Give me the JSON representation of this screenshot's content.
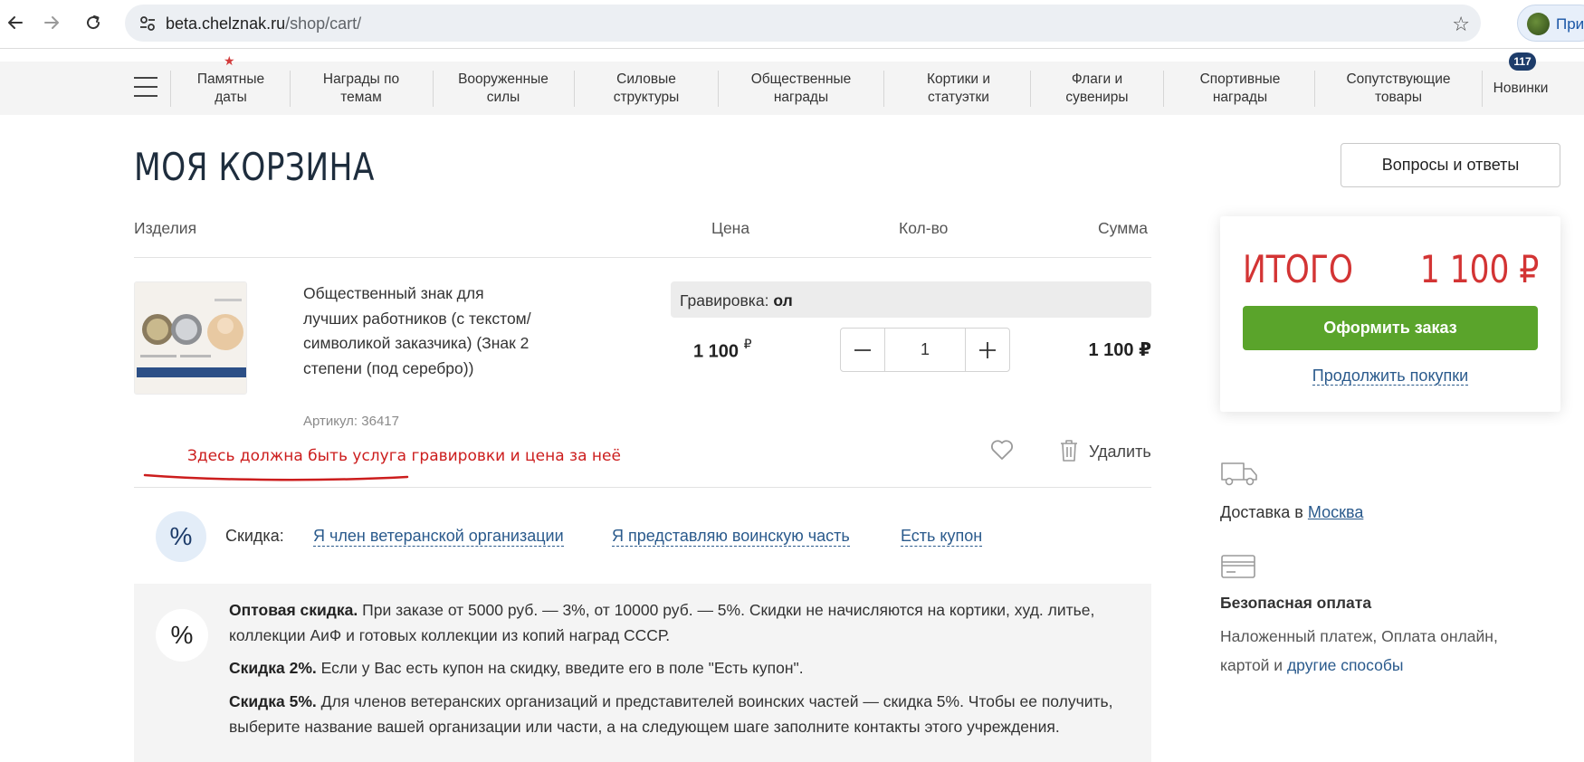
{
  "browser": {
    "url_host": "beta.chelznak.ru",
    "url_path": "/shop/cart/",
    "profile_text": "При"
  },
  "nav": {
    "items": [
      {
        "line1": "Памятные",
        "line2": "даты"
      },
      {
        "line1": "Награды по",
        "line2": "темам"
      },
      {
        "line1": "Вооруженные",
        "line2": "силы"
      },
      {
        "line1": "Силовые",
        "line2": "структуры"
      },
      {
        "line1": "Общественные",
        "line2": "награды"
      },
      {
        "line1": "Кортики и",
        "line2": "статуэтки"
      },
      {
        "line1": "Флаги и",
        "line2": "сувениры"
      },
      {
        "line1": "Спортивные",
        "line2": "награды"
      },
      {
        "line1": "Сопутствующие",
        "line2": "товары"
      },
      {
        "line1": "Новинки",
        "line2": ""
      }
    ],
    "new_badge": "117"
  },
  "page": {
    "title": "МОЯ КОРЗИНА",
    "faq_button": "Вопросы и ответы"
  },
  "cart": {
    "columns": {
      "items": "Изделия",
      "price": "Цена",
      "qty": "Кол-во",
      "sum": "Сумма"
    },
    "item": {
      "name": "Общественный знак для лучших работников (с текстом/символикой заказчика) (Знак 2 степени (под серебро))",
      "sku": "Артикул: 36417",
      "engraving_label": "Гравировка:",
      "engraving_value": "ол",
      "price": "1 100",
      "currency": "₽",
      "quantity": "1",
      "sum": "1 100 ₽",
      "delete_label": "Удалить"
    },
    "annotation": "Здесь должна быть услуга гравировки и цена за неё"
  },
  "discount": {
    "label": "Скидка:",
    "options": [
      "Я член ветеранской организации",
      "Я представляю воинскую часть",
      "Есть купон"
    ],
    "pct_symbol": "%"
  },
  "info": {
    "p1_bold": "Оптовая скидка.",
    "p1_text": " При заказе от 5000 руб. — 3%, от 10000 руб. — 5%. Скидки не начисляются на кортики, худ. литье, коллекции АиФ и готовых коллекции из копий наград СССР.",
    "p2_bold": "Скидка 2%.",
    "p2_text": " Если у Вас есть купон на скидку, введите его в поле \"Есть купон\".",
    "p3_bold": "Скидка 5%.",
    "p3_text": " Для членов ветеранских организаций и представителей воинских частей — скидка 5%. Чтобы ее получить, выберите название вашей организации или части, а на следующем шаге заполните контакты этого учреждения."
  },
  "summary": {
    "total_label": "ИТОГО",
    "total_value": "1 100 ₽",
    "checkout": "Оформить заказ",
    "continue": "Продолжить покупки"
  },
  "delivery": {
    "prefix": "Доставка в ",
    "city": "Москва"
  },
  "payment": {
    "title": "Безопасная оплата",
    "desc": "Наложенный платеж, Оплата онлайн, картой и ",
    "other": "другие способы"
  },
  "colors": {
    "accent_red": "#d33434",
    "checkout_green": "#5aa42b",
    "link_blue": "#2a5a8c",
    "navy": "#1d3c6a"
  }
}
